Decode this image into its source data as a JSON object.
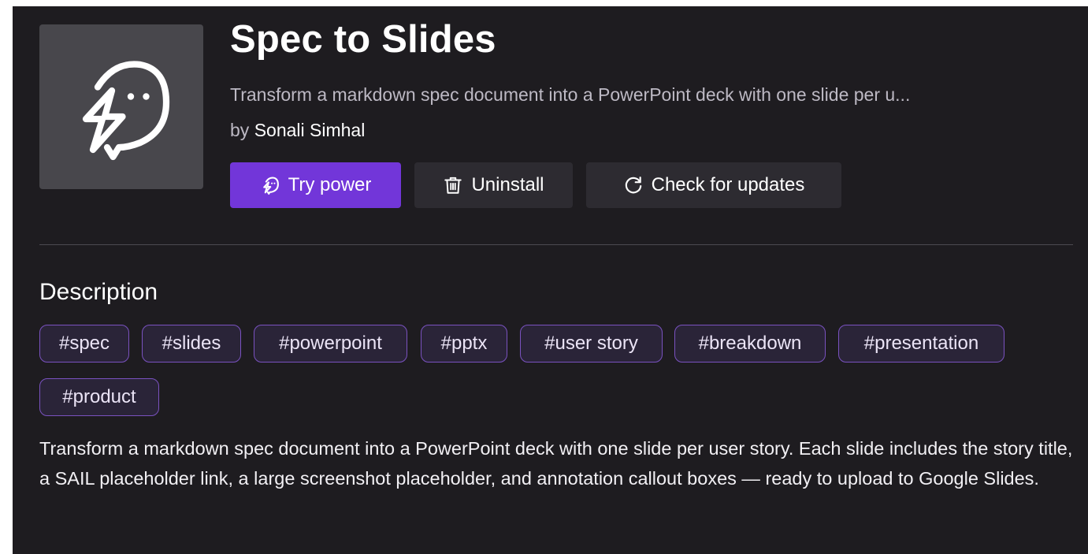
{
  "header": {
    "title": "Spec to Slides",
    "subtitle": "Transform a markdown spec document into a PowerPoint deck with one slide per u...",
    "by_prefix": "by",
    "author": "Sonali Simhal",
    "logo_icon": "ghost-lightning-icon"
  },
  "actions": {
    "try_label": "Try power",
    "try_icon": "ghost-lightning-icon",
    "uninstall_label": "Uninstall",
    "uninstall_icon": "trash-icon",
    "updates_label": "Check for updates",
    "updates_icon": "refresh-icon"
  },
  "description": {
    "heading": "Description",
    "tags": [
      "#spec",
      "#slides",
      "#powerpoint",
      "#pptx",
      "#user story",
      "#breakdown",
      "#presentation",
      "#product"
    ],
    "body": "Transform a markdown spec document into a PowerPoint deck with one slide per user story. Each slide includes the story title, a SAIL placeholder link, a large screenshot placeholder, and annotation callout boxes — ready to upload to Google Slides."
  },
  "colors": {
    "background": "#1e1c20",
    "accent": "#7236d9",
    "tag_border": "#7a52c0",
    "secondary_button": "#2d2b31"
  }
}
